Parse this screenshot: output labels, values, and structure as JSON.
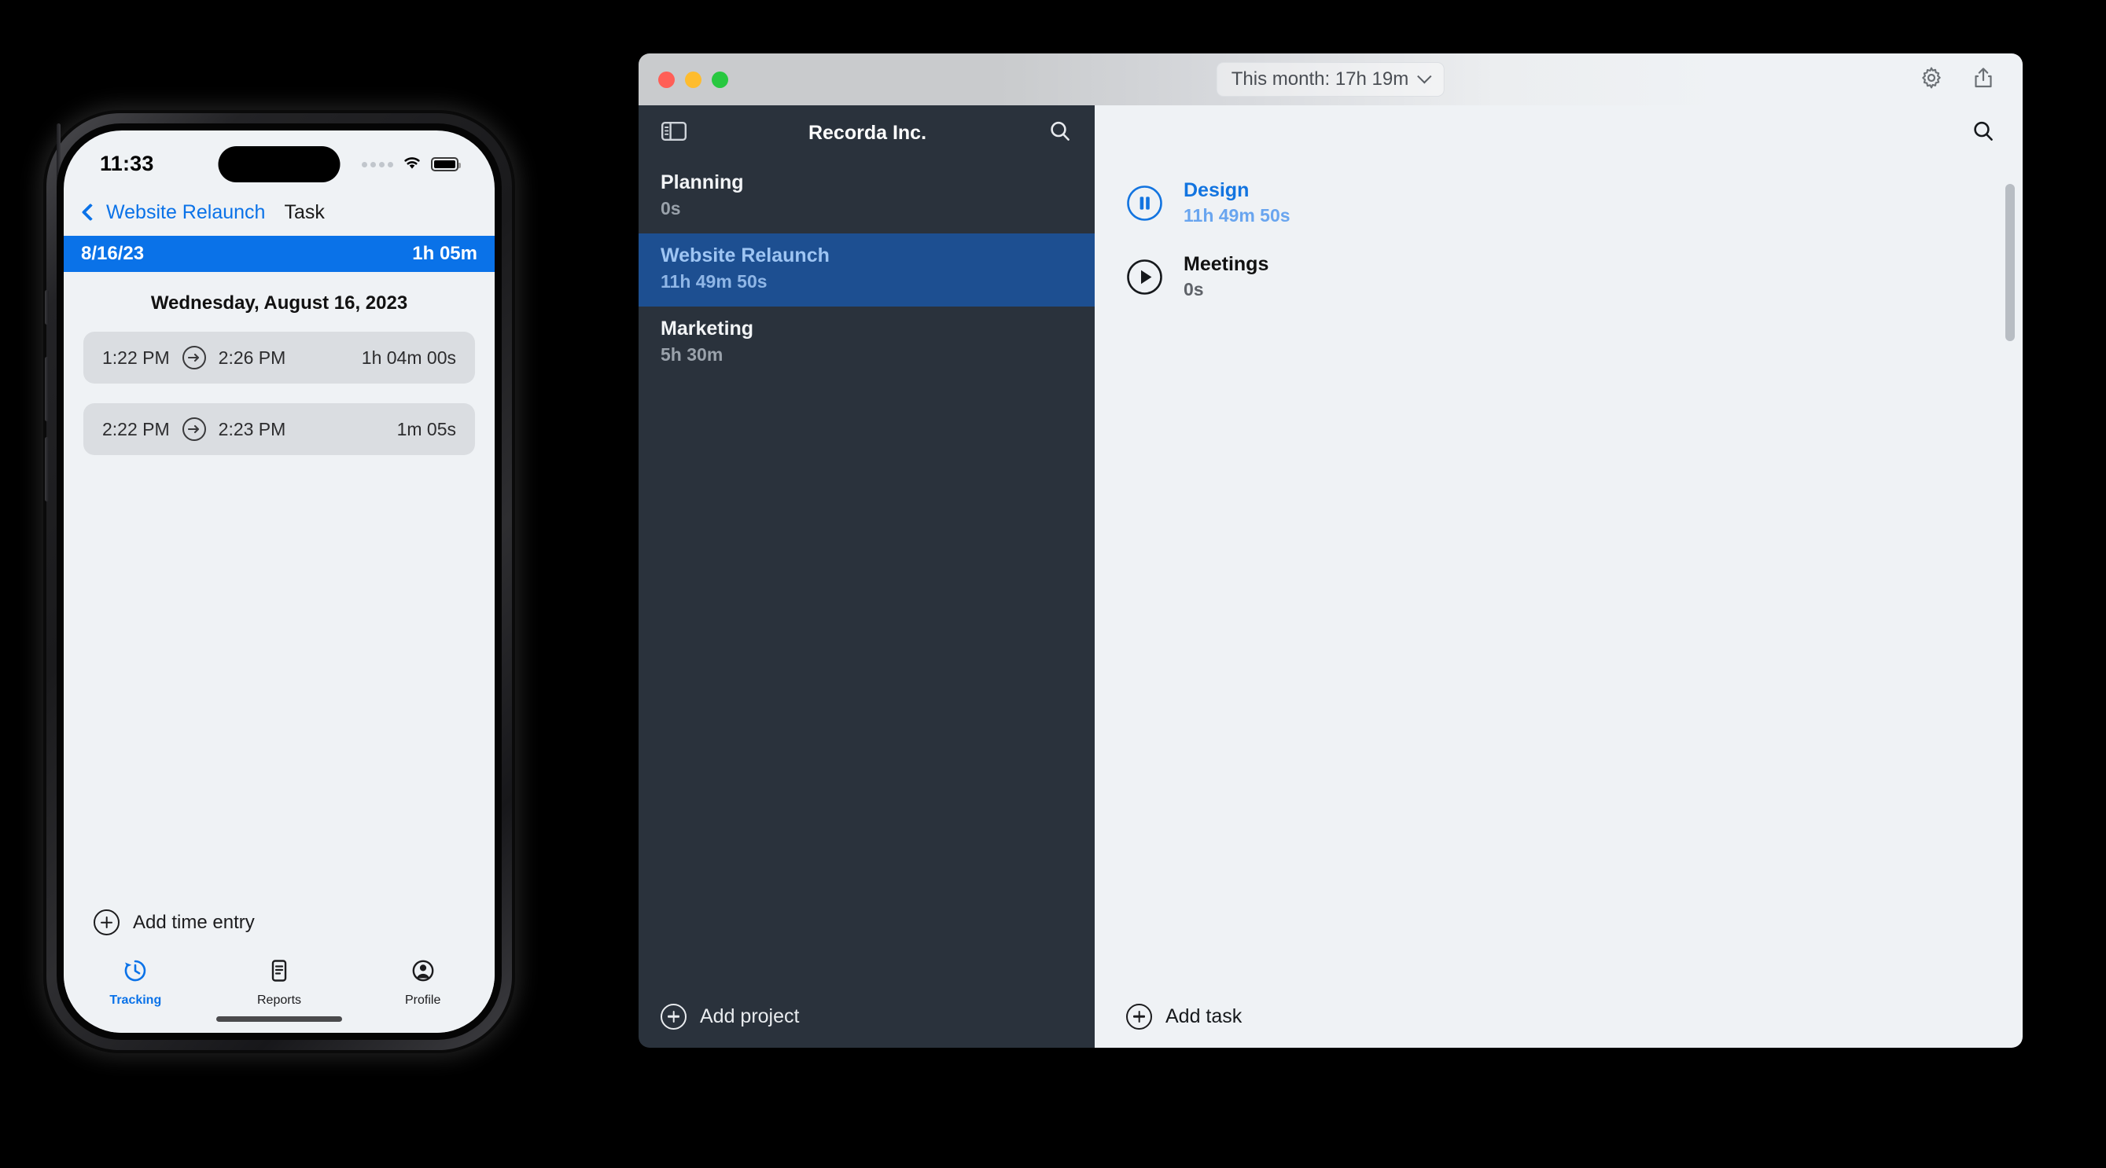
{
  "phone": {
    "status": {
      "time": "11:33",
      "cell_icon": "cellular-signal-icon",
      "wifi_icon": "wifi-icon",
      "battery_icon": "battery-icon"
    },
    "nav": {
      "back_label": "Website Relaunch",
      "title": "Task"
    },
    "date_bar": {
      "date": "8/16/23",
      "total": "1h 05m"
    },
    "day_label": "Wednesday, August 16, 2023",
    "entries": [
      {
        "start": "1:22 PM",
        "end": "2:26 PM",
        "duration": "1h 04m 00s"
      },
      {
        "start": "2:22 PM",
        "end": "2:23 PM",
        "duration": "1m 05s"
      }
    ],
    "add_entry_label": "Add time entry",
    "tabs": [
      {
        "label": "Tracking",
        "icon": "clock-arrow-icon",
        "active": true
      },
      {
        "label": "Reports",
        "icon": "document-icon",
        "active": false
      },
      {
        "label": "Profile",
        "icon": "person-circle-icon",
        "active": false
      }
    ]
  },
  "mac": {
    "titlebar": {
      "period_label": "This month: 17h 19m",
      "chevron_icon": "chevron-down-icon",
      "settings_icon": "gear-icon",
      "share_icon": "share-icon",
      "traffic_lights": [
        "close",
        "minimize",
        "zoom"
      ]
    },
    "sidebar": {
      "toggle_icon": "sidebar-toggle-icon",
      "title": "Recorda Inc.",
      "search_icon": "search-icon",
      "projects": [
        {
          "name": "Planning",
          "duration": "0s",
          "selected": false
        },
        {
          "name": "Website Relaunch",
          "duration": "11h 49m 50s",
          "selected": true
        },
        {
          "name": "Marketing",
          "duration": "5h 30m",
          "selected": false
        }
      ],
      "add_project_label": "Add project"
    },
    "content": {
      "search_icon": "search-icon",
      "tasks": [
        {
          "name": "Design",
          "duration": "11h 49m 50s",
          "state": "running",
          "icon": "pause-circle-icon"
        },
        {
          "name": "Meetings",
          "duration": "0s",
          "state": "stopped",
          "icon": "play-circle-icon"
        }
      ],
      "add_task_label": "Add task"
    }
  },
  "colors": {
    "accent_blue": "#0a72e8",
    "sidebar_bg": "#2a323c",
    "selected_row": "#1d4f91",
    "content_bg": "#eff2f5"
  }
}
